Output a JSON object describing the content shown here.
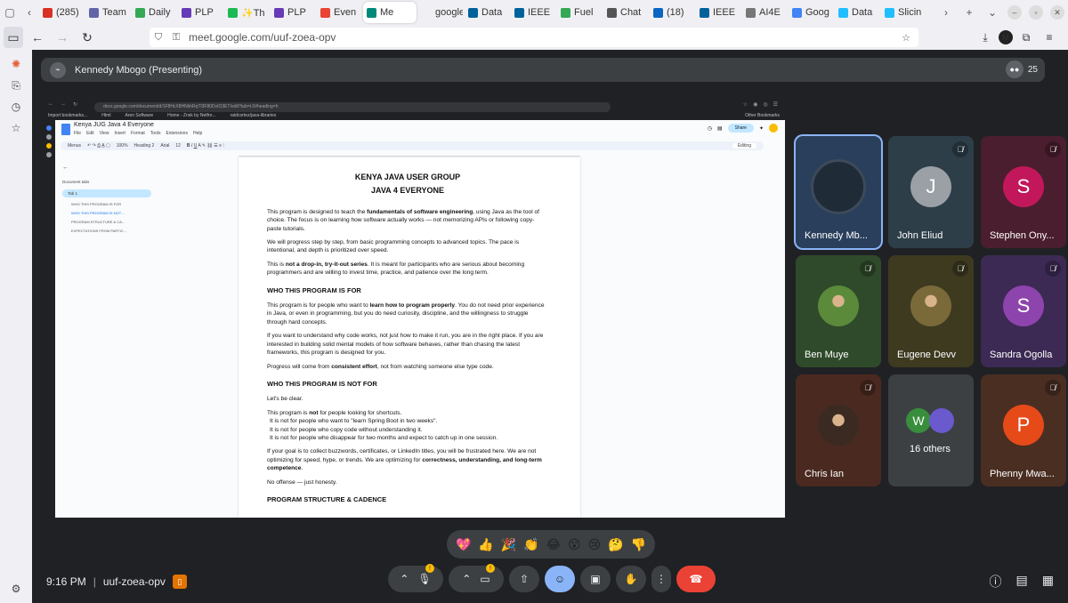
{
  "browser": {
    "tabs": [
      {
        "label": "(285)",
        "icon": "mail-icon",
        "color": "#d93025"
      },
      {
        "label": "Team",
        "icon": "teams-icon",
        "color": "#6264a7"
      },
      {
        "label": "Daily",
        "icon": "check-icon",
        "color": "#34a853"
      },
      {
        "label": "PLP",
        "icon": "plp-icon",
        "color": "#673ab7"
      },
      {
        "label": "✨Th",
        "icon": "spotify-icon",
        "color": "#1db954"
      },
      {
        "label": "PLP",
        "icon": "plp-icon",
        "color": "#673ab7"
      },
      {
        "label": "Even",
        "icon": "gmail-icon",
        "color": "#ea4335"
      },
      {
        "label": "Me",
        "icon": "meet-icon",
        "color": "#00897b",
        "active": true
      },
      {
        "label": "google.c",
        "icon": "none",
        "color": "#f0f0f4"
      },
      {
        "label": "Data",
        "icon": "ieee-icon",
        "color": "#00629b"
      },
      {
        "label": "IEEE",
        "icon": "ieee-icon",
        "color": "#00629b"
      },
      {
        "label": "Fuel",
        "icon": "fuel-icon",
        "color": "#34a853"
      },
      {
        "label": "Chat",
        "icon": "chat-icon",
        "color": "#555555"
      },
      {
        "label": "(18)",
        "icon": "linkedin-icon",
        "color": "#0a66c2"
      },
      {
        "label": "IEEE",
        "icon": "ieee-icon",
        "color": "#00629b"
      },
      {
        "label": "AI4E",
        "icon": "ai-icon",
        "color": "#777777"
      },
      {
        "label": "Goog",
        "icon": "google-icon",
        "color": "#4285f4"
      },
      {
        "label": "Data",
        "icon": "kaggle-icon",
        "color": "#20beff"
      },
      {
        "label": "Slicin",
        "icon": "kaggle-icon",
        "color": "#20beff"
      }
    ],
    "url": "meet.google.com/uuf-zoea-opv"
  },
  "meet": {
    "presenter": "Kennedy Mbogo (Presenting)",
    "participant_count": "25",
    "time": "9:16 PM",
    "meeting_code": "uuf-zoea-opv",
    "participants": [
      {
        "name": "Kennedy Mb...",
        "initial": "",
        "color": "#2a3f5c",
        "avatar_color": "#5f6368",
        "type": "photo",
        "muted": false,
        "selected": true
      },
      {
        "name": "John Eliud",
        "initial": "J",
        "color": "#2d3e48",
        "avatar_color": "#9aa0a6",
        "type": "initial",
        "muted": true
      },
      {
        "name": "Stephen Ony...",
        "initial": "S",
        "color": "#4a1e2e",
        "avatar_color": "#c2185b",
        "type": "initial",
        "muted": true
      },
      {
        "name": "Ben Muye",
        "initial": "",
        "color": "#2f4a2a",
        "avatar_color": "#5a8a3a",
        "type": "photo",
        "muted": true
      },
      {
        "name": "Eugene Devv",
        "initial": "",
        "color": "#3d3a20",
        "avatar_color": "#7a6a3a",
        "type": "photo",
        "muted": true
      },
      {
        "name": "Sandra Ogolla",
        "initial": "S",
        "color": "#3c2a54",
        "avatar_color": "#8e44ad",
        "type": "initial",
        "muted": true
      },
      {
        "name": "Chris Ian",
        "initial": "",
        "color": "#4a2a20",
        "avatar_color": "#3a2a22",
        "type": "photo",
        "muted": true
      },
      {
        "name": "16 others",
        "initial": "W",
        "color": "#3c4043",
        "avatar_color": "#388e3c",
        "type": "others",
        "muted": false
      },
      {
        "name": "Phenny Mwa...",
        "initial": "P",
        "color": "#4a2e22",
        "avatar_color": "#e64a19",
        "type": "initial",
        "muted": true
      }
    ],
    "reactions": [
      "💖",
      "👍",
      "🎉",
      "👏",
      "😂",
      "😮",
      "😢",
      "🤔",
      "👎"
    ]
  },
  "shared_screen": {
    "url": "docs.google.com/document/d/1F8HcX8HNkhRqTl3F80DvIO3ET/edit?tab=t.0#heading=h",
    "bookmarks": [
      "Import bookmarks...",
      "Html",
      "Aren Software",
      "Home - Znsk by Netfro...",
      "raidcortez/java-libraries"
    ],
    "other_bookmarks": "Other Bookmarks",
    "doc_title": "Kenya JUG Java 4 Everyone",
    "menu": [
      "File",
      "Edit",
      "View",
      "Insert",
      "Format",
      "Tools",
      "Extensions",
      "Help"
    ],
    "toolbar": [
      "Menus",
      "100%",
      "Heading 2",
      "Arial",
      "12"
    ],
    "share": "Share",
    "editing": "Editing",
    "tabs_header": "Document tabs",
    "tab1": "Tab 1",
    "outline": [
      "WHO THIS PROGRAM IS FOR",
      "WHO THIS PROGRAM IS NOT ...",
      "PROGRAM STRUCTURE & CA...",
      "EXPECTATIONS FROM PARTIC..."
    ],
    "doc": {
      "title1": "KENYA JAVA USER GROUP",
      "title2": "JAVA 4 EVERYONE",
      "p1a": "This program is designed to teach the ",
      "p1b": "fundamentals of software engineering",
      "p1c": ", using Java as the tool of choice. The focus is on learning how software actually works — not memorizing APIs or following copy-paste tutorials.",
      "p2": "We will progress step by step, from basic programming concepts to advanced topics. The pace is intentional, and depth is prioritized over speed.",
      "p3a": "This is ",
      "p3b": "not a drop-in, try-it-out series",
      "p3c": ". It is meant for participants who are serious about becoming programmers and are willing to invest time, practice, and patience over the long term.",
      "h1": "WHO THIS PROGRAM IS FOR",
      "p4a": "This program is for people who want to ",
      "p4b": "learn how to program properly",
      "p4c": ". You do not need prior experience in Java, or even in programming, but you do need curiosity, discipline, and the willingness to struggle through hard concepts.",
      "p5": "If you want to understand why code works, not just how to make it run, you are in the right place. If you are interested in building solid mental models of how software behaves, rather than chasing the latest frameworks, this program is designed for you.",
      "p6a": "Progress will come from ",
      "p6b": "consistent effort",
      "p6c": ", not from watching someone else type code.",
      "h2": "WHO THIS PROGRAM IS NOT FOR",
      "p7": "Let's be clear.",
      "p8a": "This program is ",
      "p8b": "not",
      "p8c": " for people looking for shortcuts.",
      "l1": "It is not for people who want to \"learn Spring Boot in two weeks\".",
      "l2": "It is not for people who copy code without understanding it.",
      "l3": "It is not for people who disappear for two months and expect to catch up in one session.",
      "p9a": "If your goal is to collect buzzwords, certificates, or LinkedIn titles, you will be frustrated here. We are not optimizing for speed, hype, or trends. We are optimizing for ",
      "p9b": "correctness, understanding, and long-term competence",
      "p9c": ".",
      "p10": "No offense — just honesty.",
      "h3": "PROGRAM STRUCTURE & CADENCE"
    }
  }
}
